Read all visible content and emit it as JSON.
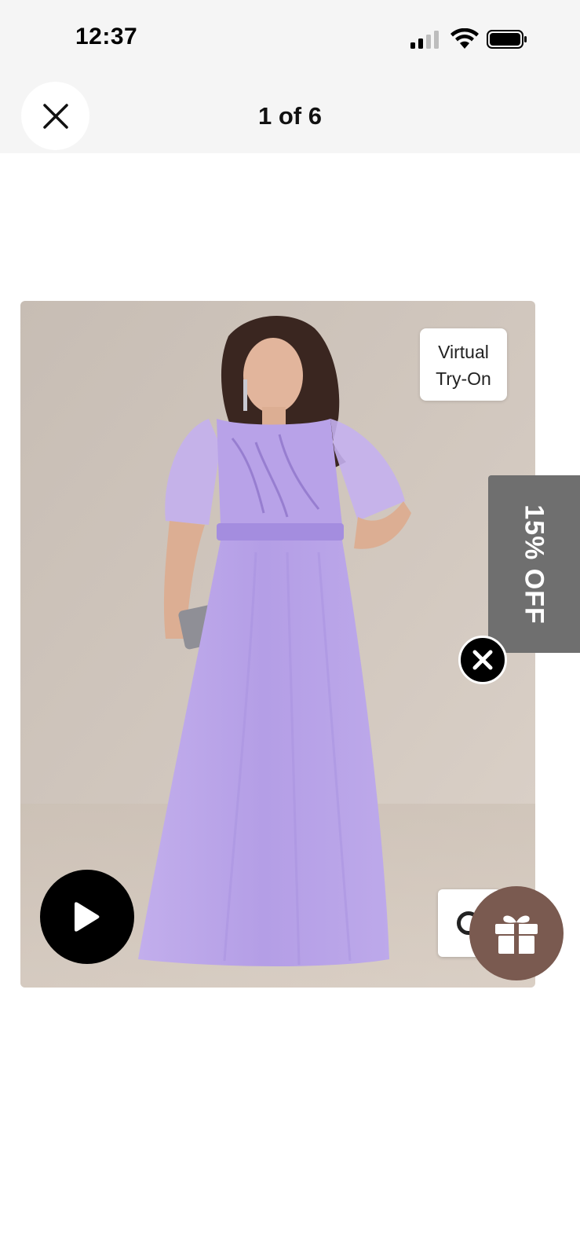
{
  "status_bar": {
    "time": "12:37",
    "signal_icon": "cellular-signal-icon",
    "wifi_icon": "wifi-icon",
    "battery_icon": "battery-icon"
  },
  "header": {
    "close_icon": "close-icon",
    "counter": "1 of 6"
  },
  "gallery": {
    "current_index": 1,
    "total": 6,
    "image_description": "product-photo",
    "virtual_try_on": {
      "line1": "Virtual",
      "line2": "Try-On"
    },
    "discount_tab": {
      "label": "15% OFF"
    },
    "dismiss_icon": "close-circle-icon",
    "play_icon": "play-icon",
    "gift_icon": "gift-icon"
  },
  "colors": {
    "discount_bg": "#6f6f6f",
    "gift_bg": "#7a5a50",
    "dress": "#b9a4e8"
  }
}
